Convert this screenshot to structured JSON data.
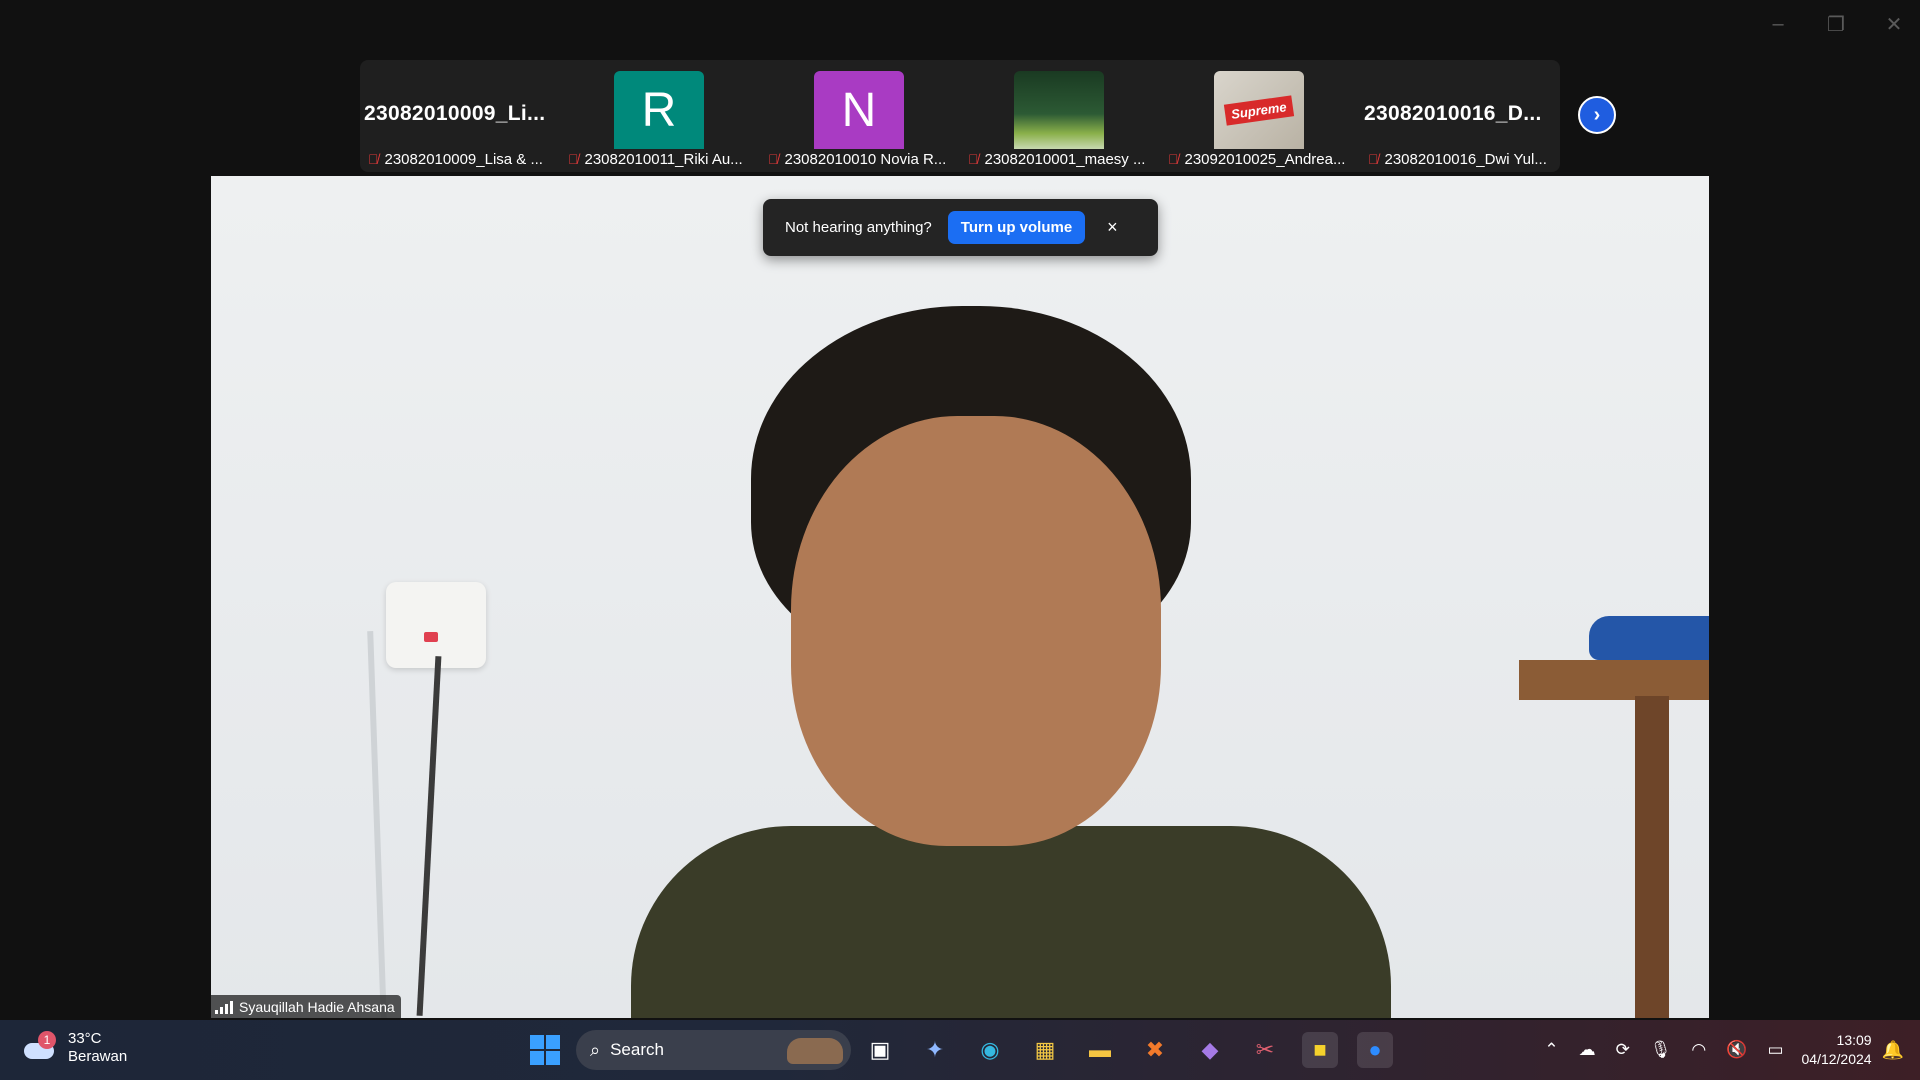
{
  "window": {
    "controls": [
      "minimize",
      "restore",
      "close"
    ]
  },
  "participants": [
    {
      "big_name": "23082010009_Li...",
      "caption": "23082010009_Lisa & ...",
      "avatar_type": "name"
    },
    {
      "avatar_letter": "R",
      "avatar_color": "#00897b",
      "caption": "23082010011_Riki Au...",
      "avatar_type": "letter"
    },
    {
      "avatar_letter": "N",
      "avatar_color": "#a93bc3",
      "caption": "23082010010 Novia R...",
      "avatar_type": "letter"
    },
    {
      "caption": "23082010001_maesy ...",
      "avatar_type": "photo"
    },
    {
      "caption": "23092010025_Andrea...",
      "avatar_type": "supreme",
      "badge_text": "Supreme"
    },
    {
      "big_name": "23082010016_D...",
      "caption": "23082010016_Dwi Yul...",
      "avatar_type": "name"
    }
  ],
  "toast": {
    "message": "Not hearing anything?",
    "button": "Turn up volume",
    "close": "×"
  },
  "speaker": {
    "name": "Syauqillah Hadie Ahsana"
  },
  "taskbar": {
    "weather": {
      "temp": "33°C",
      "desc": "Berawan",
      "badge": "1"
    },
    "search_label": "Search",
    "clock": {
      "time": "13:09",
      "date": "04/12/2024"
    },
    "apps": [
      "start-icon",
      "task-view-icon",
      "copilot-icon",
      "edge-icon",
      "store-icon",
      "file-explorer-icon",
      "xampp-icon",
      "visual-studio-icon",
      "snipping-tool-icon",
      "sticky-notes-icon",
      "zoom-icon"
    ]
  }
}
